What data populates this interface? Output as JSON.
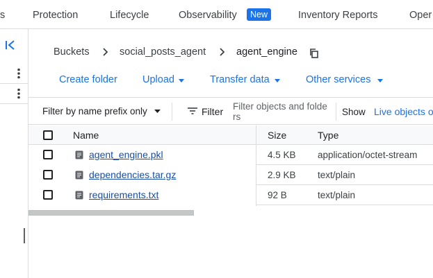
{
  "tabs": [
    {
      "label": "s"
    },
    {
      "label": "Protection"
    },
    {
      "label": "Lifecycle"
    },
    {
      "label": "Observability"
    },
    {
      "label": "Inventory Reports"
    },
    {
      "label": "Oper"
    }
  ],
  "observability_badge": "New",
  "breadcrumb": {
    "items": [
      "Buckets",
      "social_posts_agent",
      "agent_engine"
    ]
  },
  "actions": {
    "create_folder": "Create folder",
    "upload": "Upload",
    "transfer_data": "Transfer data",
    "other_services": "Other services"
  },
  "filter": {
    "mode_select": "Filter by name prefix only",
    "filter_label": "Filter",
    "placeholder": "Filter objects and folders",
    "show_label": "Show",
    "live_objects": "Live objects o"
  },
  "table": {
    "columns": {
      "name": "Name",
      "size": "Size",
      "type": "Type"
    },
    "rows": [
      {
        "name": "agent_engine.pkl",
        "size": "4.5 KB",
        "type": "application/octet-stream"
      },
      {
        "name": "dependencies.tar.gz",
        "size": "2.9 KB",
        "type": "text/plain"
      },
      {
        "name": "requirements.txt",
        "size": "92 B",
        "type": "text/plain"
      }
    ]
  },
  "colors": {
    "accent": "#1a73e8",
    "border": "#dadce0"
  }
}
